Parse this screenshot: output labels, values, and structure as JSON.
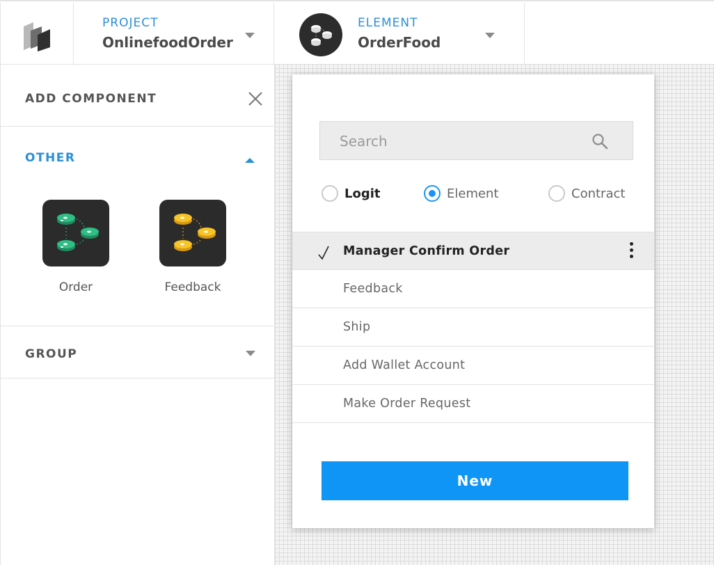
{
  "header": {
    "project": {
      "label": "PROJECT",
      "value": "OnlinefoodOrder"
    },
    "element": {
      "label": "ELEMENT",
      "value": "OrderFood"
    }
  },
  "sidebar": {
    "title": "ADD COMPONENT",
    "sections": [
      {
        "title": "OTHER",
        "expanded": true,
        "components": [
          {
            "label": "Order",
            "icon": "coins-network-green-icon",
            "color": "#2aa876"
          },
          {
            "label": "Feedback",
            "icon": "coins-network-yellow-icon",
            "color": "#f2b51d"
          }
        ]
      },
      {
        "title": "GROUP",
        "expanded": false
      }
    ]
  },
  "dialog": {
    "search": {
      "placeholder": "Search",
      "value": ""
    },
    "radios": [
      {
        "label": "Logit",
        "selected": false
      },
      {
        "label": "Element",
        "selected": true
      },
      {
        "label": "Contract",
        "selected": false
      }
    ],
    "items": [
      {
        "label": "Manager Confirm Order",
        "active": true
      },
      {
        "label": "Feedback",
        "active": false
      },
      {
        "label": "Ship",
        "active": false
      },
      {
        "label": "Add Wallet Account",
        "active": false
      },
      {
        "label": "Make Order Request",
        "active": false
      }
    ],
    "new_button": "New"
  },
  "colors": {
    "accent": "#2b8fd8",
    "button": "#0e95f5"
  }
}
